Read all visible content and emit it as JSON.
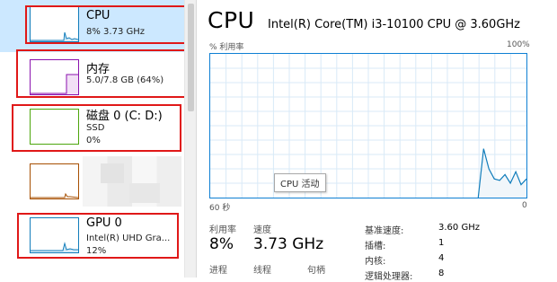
{
  "sidebar": {
    "items": [
      {
        "name": "CPU",
        "sub1": "8% 3.73 GHz",
        "sub2": "",
        "color": "#117dbb",
        "selected": true
      },
      {
        "name": "内存",
        "sub1": "5.0/7.8 GB (64%)",
        "sub2": "",
        "color": "#8b12ae"
      },
      {
        "name": "磁盘 0 (C: D:)",
        "sub1": "SSD",
        "sub2": "0%",
        "color": "#4da60c"
      },
      {
        "name": "",
        "sub1": "",
        "sub2": "",
        "color": "#a74f01"
      },
      {
        "name": "GPU 0",
        "sub1": "Intel(R) UHD Gra...",
        "sub2": "12%",
        "color": "#117dbb"
      }
    ]
  },
  "main": {
    "title": "CPU",
    "model": "Intel(R) Core(TM) i3-10100 CPU @ 3.60GHz",
    "graph": {
      "y_label": "% 利用率",
      "y_max_label": "100%",
      "x_left_label": "60 秒",
      "x_right_label": "0",
      "tooltip": "CPU 活动",
      "utilization_history": [
        0,
        0,
        0,
        0,
        0,
        0,
        0,
        0,
        0,
        0,
        0,
        0,
        0,
        0,
        0,
        0,
        0,
        0,
        0,
        0,
        0,
        0,
        0,
        0,
        0,
        0,
        0,
        0,
        0,
        0,
        0,
        0,
        0,
        0,
        0,
        0,
        0,
        0,
        0,
        0,
        0,
        0,
        0,
        0,
        0,
        0,
        0,
        0,
        0,
        0,
        0,
        34,
        20,
        13,
        12,
        16,
        10,
        18,
        9,
        13
      ]
    },
    "stats": {
      "util_label": "利用率",
      "util_value": "8%",
      "speed_label": "速度",
      "speed_value": "3.73 GHz",
      "process_label": "进程",
      "thread_label": "线程",
      "handle_label": "句柄"
    },
    "details": [
      {
        "key": "基准速度:",
        "value": "3.60 GHz"
      },
      {
        "key": "插槽:",
        "value": "1"
      },
      {
        "key": "内核:",
        "value": "4"
      },
      {
        "key": "逻辑处理器:",
        "value": "8"
      }
    ]
  }
}
